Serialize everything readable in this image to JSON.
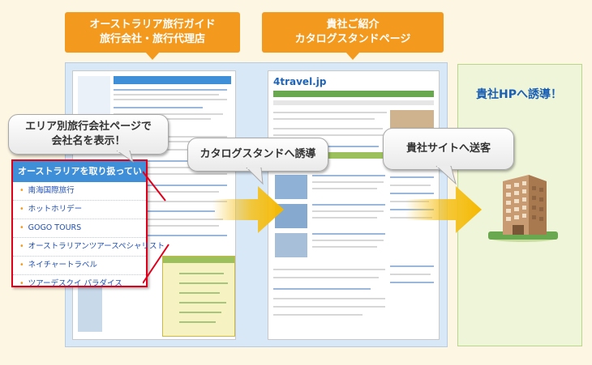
{
  "labels": {
    "tab_left_line1": "オーストラリア旅行ガイド",
    "tab_left_line2": "旅行会社・旅行代理店",
    "tab_mid_line1": "貴社ご紹介",
    "tab_mid_line2": "カタログスタンドページ",
    "hp_title": "貴社HPへ誘導！",
    "bubble_company_line1": "エリア別旅行会社ページで",
    "bubble_company_line2": "会社名を表示！",
    "bubble_catalog": "カタログスタンドへ誘導",
    "bubble_site": "貴社サイトへ送客",
    "site_logo": "4travel.jp"
  },
  "company_list": {
    "header": "オーストラリアを取り扱ってい",
    "items": [
      "南海国際旅行",
      "ホットホリデー",
      "GOGO TOURS",
      "オーストラリアンツアースペシャリスト",
      "ネイチャートラベル",
      "ツアーデスクイ パラダイス"
    ]
  },
  "colors": {
    "orange": "#f39a1e",
    "blue_panel": "#d9e8f7",
    "green_panel": "#eef5d9",
    "accent_red": "#e0001b",
    "link_blue": "#1f4fb5"
  }
}
